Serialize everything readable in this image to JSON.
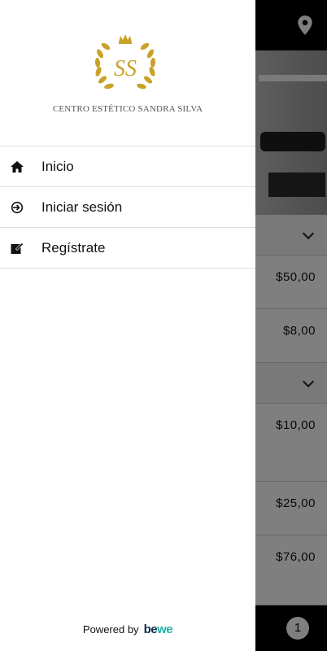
{
  "drawer": {
    "brand_name": "CENTRO ESTÉTICO SANDRA SILVA",
    "logo_letters": "SS",
    "menu": [
      {
        "label": "Inicio",
        "icon": "home-icon"
      },
      {
        "label": "Iniciar sesión",
        "icon": "login-icon"
      },
      {
        "label": "Regístrate",
        "icon": "edit-icon"
      }
    ],
    "footer": {
      "powered_by": "Powered by",
      "brand": "bewe"
    }
  },
  "background": {
    "prices": [
      "$50,00",
      "$8,00",
      "$10,00",
      "$25,00",
      "$76,00"
    ],
    "cart_count": "1"
  },
  "colors": {
    "header_bg": "#000000",
    "overlay": "rgba(0,0,0,0.5)",
    "logo_gold": "#c9a227",
    "bewe_navy": "#0f2a4a",
    "bewe_teal": "#17b3a3"
  }
}
